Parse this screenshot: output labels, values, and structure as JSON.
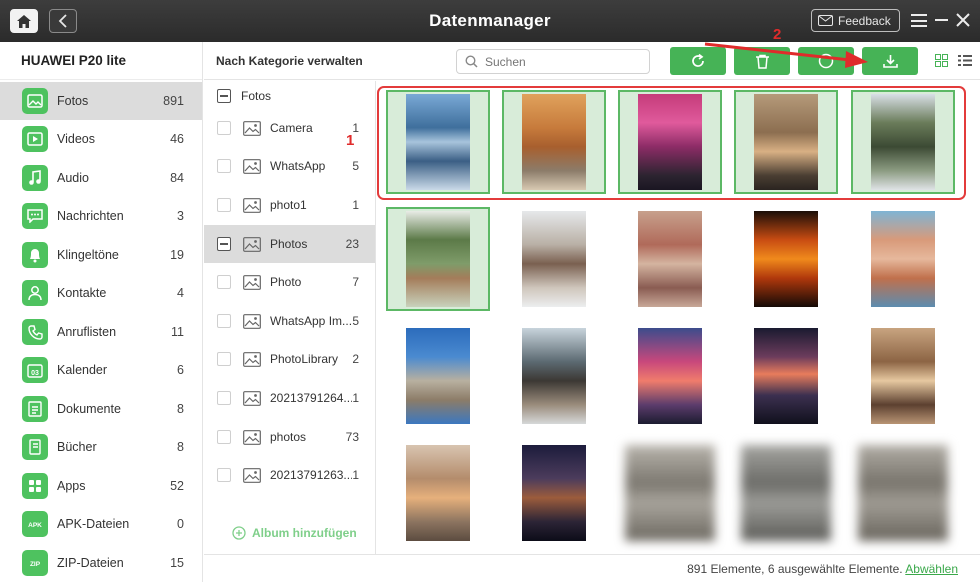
{
  "window": {
    "title": "Datenmanager",
    "feedback_label": "Feedback"
  },
  "device": {
    "name": "HUAWEI P20 lite"
  },
  "categories": [
    {
      "label": "Fotos",
      "count": "891",
      "icon": "photo-icon"
    },
    {
      "label": "Videos",
      "count": "46",
      "icon": "video-icon"
    },
    {
      "label": "Audio",
      "count": "84",
      "icon": "music-icon"
    },
    {
      "label": "Nachrichten",
      "count": "3",
      "icon": "message-icon"
    },
    {
      "label": "Klingeltöne",
      "count": "19",
      "icon": "bell-icon"
    },
    {
      "label": "Kontakte",
      "count": "4",
      "icon": "contact-icon"
    },
    {
      "label": "Anruflisten",
      "count": "11",
      "icon": "phone-icon"
    },
    {
      "label": "Kalender",
      "count": "6",
      "icon": "calendar-icon"
    },
    {
      "label": "Dokumente",
      "count": "8",
      "icon": "document-icon"
    },
    {
      "label": "Bücher",
      "count": "8",
      "icon": "book-icon"
    },
    {
      "label": "Apps",
      "count": "52",
      "icon": "apps-icon"
    },
    {
      "label": "APK-Dateien",
      "count": "0",
      "icon": "apk-icon"
    },
    {
      "label": "ZIP-Dateien",
      "count": "15",
      "icon": "zip-icon"
    }
  ],
  "header": {
    "manage_label": "Nach Kategorie verwalten",
    "search_placeholder": "Suchen"
  },
  "albums": {
    "root_label": "Fotos",
    "items": [
      {
        "label": "Camera",
        "count": "1"
      },
      {
        "label": "WhatsApp",
        "count": "5"
      },
      {
        "label": "photo1",
        "count": "1"
      },
      {
        "label": "Photos",
        "count": "23"
      },
      {
        "label": "Photo",
        "count": "7"
      },
      {
        "label": "WhatsApp Im...",
        "count": "5"
      },
      {
        "label": "PhotoLibrary",
        "count": "2"
      },
      {
        "label": "20213791264...",
        "count": "1"
      },
      {
        "label": "photos",
        "count": "73"
      },
      {
        "label": "20213791263...",
        "count": "1"
      }
    ],
    "add_label": "Album hinzufügen"
  },
  "status": {
    "text": "891 Elemente, 6 ausgewählte Elemente.",
    "deselect_label": "Abwählen"
  },
  "annotations": {
    "step1": "1",
    "step2": "2"
  },
  "colors": {
    "accent": "#46b356",
    "selection_fill": "#d8ecd9",
    "annotation_red": "#e02b2b"
  }
}
